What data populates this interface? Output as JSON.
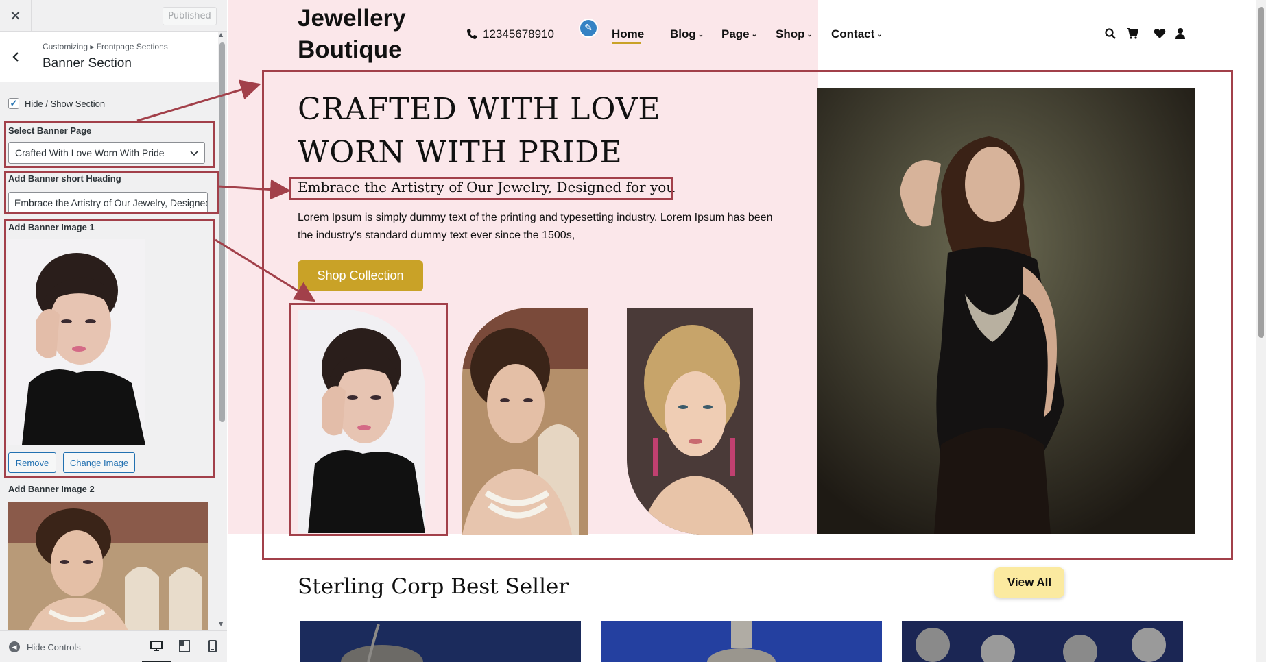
{
  "customizer": {
    "close_label": "✕",
    "publish_label": "Published",
    "breadcrumb": "Customizing ▸ Frontpage Sections",
    "section_title": "Banner Section",
    "hide_show_label": "Hide / Show Section",
    "hide_show_checked": true,
    "select_page_label": "Select Banner Page",
    "select_page_value": "Crafted With Love Worn With Pride",
    "short_heading_label": "Add Banner short Heading",
    "short_heading_value": "Embrace the Artistry of Our Jewelry, Designed for you",
    "image1_label": "Add Banner Image 1",
    "remove_label": "Remove",
    "change_image_label": "Change Image",
    "image2_label": "Add Banner Image 2",
    "hide_controls_label": "Hide Controls",
    "devices": [
      "desktop-icon",
      "tablet-icon",
      "mobile-icon"
    ]
  },
  "site": {
    "brand_line1": "Jewellery",
    "brand_line2": "Boutique",
    "phone": "12345678910",
    "nav": [
      {
        "label": "Home",
        "dropdown": false,
        "active": true
      },
      {
        "label": "Blog",
        "dropdown": true
      },
      {
        "label": "Page",
        "dropdown": true
      },
      {
        "label": "Shop",
        "dropdown": true
      },
      {
        "label": "Contact",
        "dropdown": true
      }
    ],
    "header_icons": [
      "search-icon",
      "cart-icon",
      "heart-icon",
      "user-icon"
    ],
    "hero": {
      "title_line1": "CRAFTED WITH LOVE",
      "title_line2": "WORN WITH PRIDE",
      "subheading": "Embrace the Artistry of Our Jewelry, Designed for you",
      "text": "Lorem Ipsum is simply dummy text of the printing and typesetting industry. Lorem Ipsum has been the industry's standard dummy text ever since the 1500s,",
      "button": "Shop Collection"
    },
    "bestseller": {
      "title": "Sterling Corp Best Seller",
      "view_all": "View All"
    }
  },
  "colors": {
    "accent_gold": "#c9a227",
    "hero_pink": "#fbe7ea",
    "annotation_red": "#a2404a",
    "wp_blue": "#2271b1",
    "view_all_bg": "#fbeaa0"
  }
}
